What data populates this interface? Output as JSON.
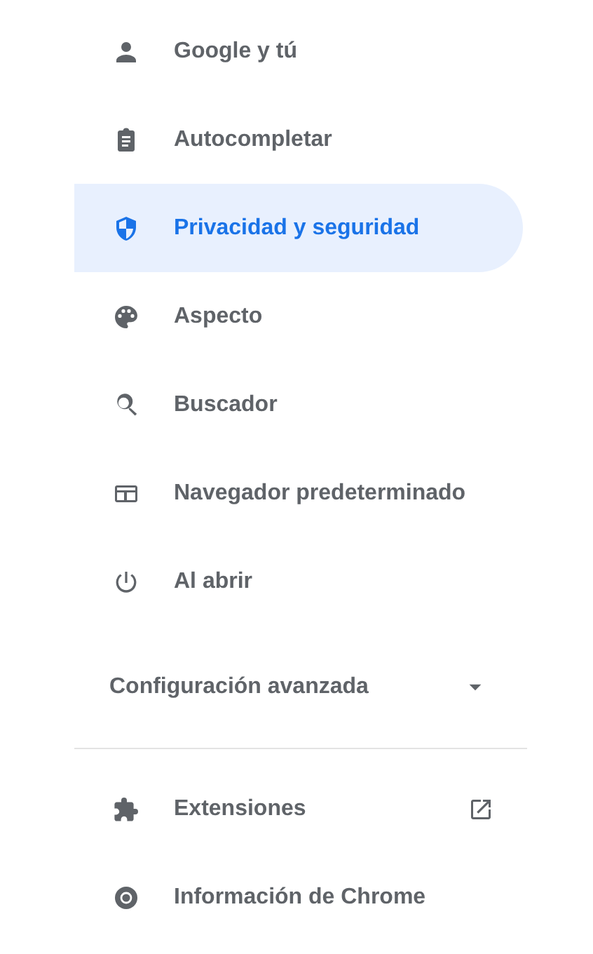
{
  "menu": [
    {
      "label": "Google y tú",
      "selected": false
    },
    {
      "label": "Autocompletar",
      "selected": false
    },
    {
      "label": "Privacidad y seguridad",
      "selected": true
    },
    {
      "label": "Aspecto",
      "selected": false
    },
    {
      "label": "Buscador",
      "selected": false
    },
    {
      "label": "Navegador predeterminado",
      "selected": false
    },
    {
      "label": "Al abrir",
      "selected": false
    }
  ],
  "advanced": {
    "label": "Configuración avanzada",
    "expanded": false
  },
  "extra_links": [
    {
      "label": "Extensiones",
      "kind": "external"
    },
    {
      "label": "Información de Chrome",
      "kind": "about"
    }
  ]
}
